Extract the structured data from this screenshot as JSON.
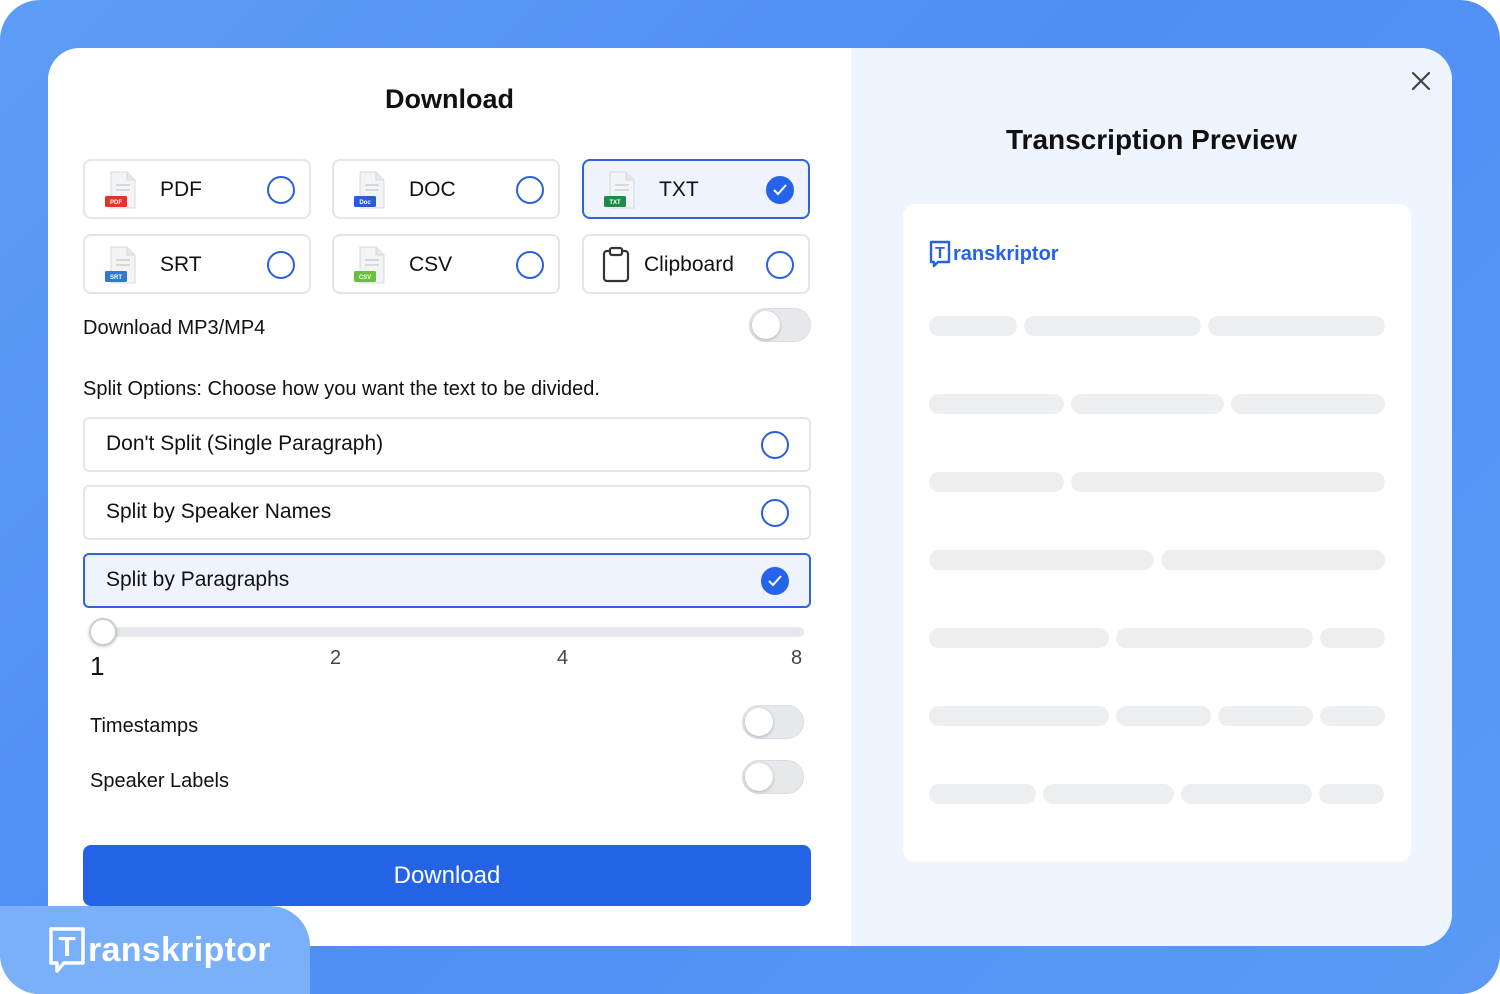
{
  "modal": {
    "title": "Download",
    "formats": [
      {
        "label": "PDF",
        "badge": "PDF",
        "color": "#e5332a",
        "selected": false
      },
      {
        "label": "DOC",
        "badge": "Doc",
        "color": "#2b5cd6",
        "selected": false
      },
      {
        "label": "TXT",
        "badge": "TXT",
        "color": "#1f8a4c",
        "selected": true
      },
      {
        "label": "SRT",
        "badge": "SRT",
        "color": "#2f7bd0",
        "selected": false
      },
      {
        "label": "CSV",
        "badge": "CSV",
        "color": "#6cbf3c",
        "selected": false
      },
      {
        "label": "Clipboard",
        "badge": "",
        "color": "#333333",
        "selected": false
      }
    ],
    "download_media_label": "Download MP3/MP4",
    "split_prompt": "Split Options: Choose how you want the text to be divided.",
    "split_options": [
      {
        "label": "Don't Split (Single Paragraph)",
        "selected": false
      },
      {
        "label": "Split by Speaker Names",
        "selected": false
      },
      {
        "label": "Split by Paragraphs",
        "selected": true
      }
    ],
    "slider": {
      "ticks": [
        "1",
        "2",
        "4",
        "8"
      ],
      "value": "1"
    },
    "timestamps_label": "Timestamps",
    "speaker_labels_label": "Speaker Labels",
    "download_button": "Download"
  },
  "preview": {
    "title": "Transcription Preview",
    "logo_text": "ranskriptor",
    "logo_letter": "T"
  },
  "brand": {
    "logo_letter": "T",
    "logo_text": "ranskriptor"
  },
  "colors": {
    "accent": "#2563e6",
    "background": "#5d9cf6",
    "preview_bg": "#eef5fe"
  }
}
